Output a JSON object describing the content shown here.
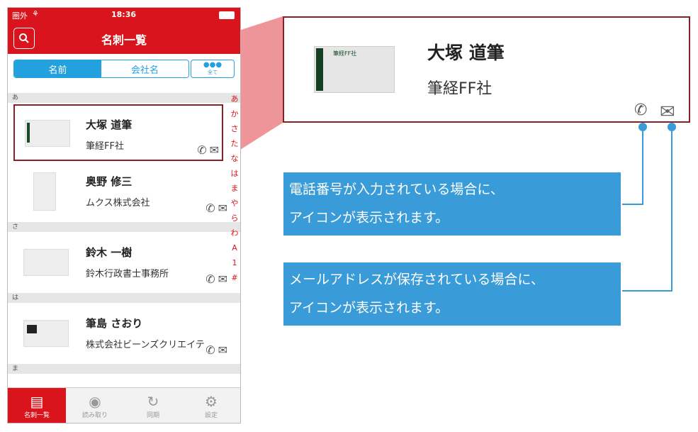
{
  "status": {
    "carrier": "圏外",
    "time": "18:36"
  },
  "nav": {
    "title": "名刺一覧"
  },
  "segment": {
    "name": "名前",
    "company": "会社名",
    "all": "全て"
  },
  "sections": [
    "あ",
    "さ",
    "は",
    "ま"
  ],
  "contacts": [
    {
      "name": "大塚 道筆",
      "company": "筆経FF社"
    },
    {
      "name": "奥野 修三",
      "company": "ムクス株式会社"
    },
    {
      "name": "鈴木 一樹",
      "company": "鈴木行政書士事務所"
    },
    {
      "name": "筆島 さおり",
      "company": "株式会社ビーンズクリエイテ"
    }
  ],
  "index": [
    "あ",
    "か",
    "さ",
    "た",
    "な",
    "は",
    "ま",
    "や",
    "ら",
    "わ",
    "A",
    "1",
    "#"
  ],
  "tabs": [
    "名刺一覧",
    "読み取り",
    "同期",
    "設定"
  ],
  "zoom": {
    "name": "大塚 道筆",
    "company": "筆経FF社",
    "card_text": "筆経FF社"
  },
  "notes": {
    "phone": [
      "電話番号が入力されている場合に、",
      "アイコンが表示されます。"
    ],
    "mail": [
      "メールアドレスが保存されている場合に、",
      "アイコンが表示されます。"
    ]
  },
  "colors": {
    "brand": "#d9141c",
    "accent": "#23a0de",
    "callout": "#3a9bd9",
    "frame": "#8a1f26"
  }
}
